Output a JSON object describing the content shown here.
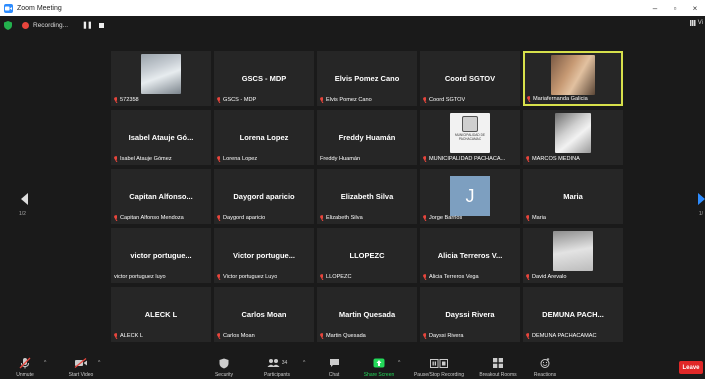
{
  "window": {
    "title": "Zoom Meeting"
  },
  "status": {
    "recording_label": "Recording...",
    "view_label": "Vi"
  },
  "gallery": {
    "page_left": "1/2",
    "page_right": "1/"
  },
  "tiles": [
    {
      "display": "",
      "label": "572358",
      "muted": true,
      "photo": "mask"
    },
    {
      "display": "GSCS - MDP",
      "label": "GSCS - MDP",
      "muted": true
    },
    {
      "display": "Elvis Pomez Cano",
      "label": "Elvis Pomez Cano",
      "muted": true
    },
    {
      "display": "Coord SGTOV",
      "label": "Coord SGTOV",
      "muted": true
    },
    {
      "display": "",
      "label": "Mariafernanda Galicia",
      "muted": true,
      "photo": "girl",
      "active": true
    },
    {
      "display": "Isabel Atauje Gó...",
      "label": "Isabel Atauje Gómez",
      "muted": true
    },
    {
      "display": "Lorena Lopez",
      "label": "Lorena Lopez",
      "muted": true
    },
    {
      "display": "Freddy Huamán",
      "label": "Freddy Huamán",
      "muted": false
    },
    {
      "display": "",
      "label": "MUNICIPALIDAD PACHACA...",
      "muted": true,
      "photo": "seal",
      "seal_text": "MUNICIPALIDAD DE PACHACAMAC"
    },
    {
      "display": "",
      "label": "MARCOS MEDINA",
      "muted": true,
      "photo": "selfie"
    },
    {
      "display": "Capitan Alfonso...",
      "label": "Capitan Alfonso Mendoza",
      "muted": true
    },
    {
      "display": "Daygord aparicio",
      "label": "Daygord aparicio",
      "muted": true
    },
    {
      "display": "Elizabeth Silva",
      "label": "Elizabeth Silva",
      "muted": true
    },
    {
      "display": "",
      "label": "Jorge Barrios",
      "muted": true,
      "avatar": "J"
    },
    {
      "display": "Maria",
      "label": "Maria",
      "muted": true
    },
    {
      "display": "victor portugue...",
      "label": "victor portuguez luyo",
      "muted": false
    },
    {
      "display": "Victor portugue...",
      "label": "Victor portuguez Luyo",
      "muted": true
    },
    {
      "display": "LLOPEZC",
      "label": "LLOPEZC",
      "muted": true
    },
    {
      "display": "Alicia Terreros V...",
      "label": "Alicia Terreros Vega",
      "muted": true
    },
    {
      "display": "",
      "label": "David Arevalo",
      "muted": true,
      "photo": "davidp"
    },
    {
      "display": "ALECK L",
      "label": "ALECK L",
      "muted": true
    },
    {
      "display": "Carlos Moan",
      "label": "Carlos Moan",
      "muted": true
    },
    {
      "display": "Martin Quesada",
      "label": "Martin Quesada",
      "muted": true
    },
    {
      "display": "Dayssi Rivera",
      "label": "Dayssi Rivera",
      "muted": true
    },
    {
      "display": "DEMUNA PACH...",
      "label": "DEMUNA PACHACAMAC",
      "muted": true
    }
  ],
  "toolbar": {
    "unmute": "Unmute",
    "start_video": "Start Video",
    "security": "Security",
    "participants": "Participants",
    "participant_count": "34",
    "chat": "Chat",
    "share_screen": "Share Screen",
    "recording": "Pause/Stop Recording",
    "breakout": "Breakout Rooms",
    "reactions": "Reactions",
    "leave": "Leave"
  },
  "colors": {
    "active_border": "#d7e04b",
    "mute_red": "#e8453c",
    "share_green": "#23d959",
    "leave_red": "#e02828"
  }
}
